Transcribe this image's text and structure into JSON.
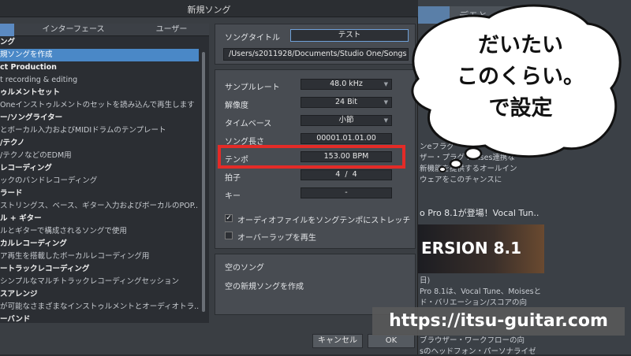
{
  "dialog": {
    "title": "新規ソング"
  },
  "category_tabs": [
    {
      "label": ""
    },
    {
      "label": "インターフェース"
    },
    {
      "label": "ユーザー"
    }
  ],
  "templates": [
    {
      "label": "ング",
      "kind": "head"
    },
    {
      "label": "規ソングを作成",
      "kind": "selected"
    },
    {
      "label": "ct Production",
      "kind": "head"
    },
    {
      "label": "t recording & editing",
      "kind": "sub"
    },
    {
      "label": "ゥルメントセット",
      "kind": "head"
    },
    {
      "label": "Oneインストゥルメントのセットを読み込んで再生します",
      "kind": "sub"
    },
    {
      "label": "ー/ソングライター",
      "kind": "head"
    },
    {
      "label": "とボーカル入力およびMIDIドラムのテンプレート",
      "kind": "sub"
    },
    {
      "label": "/テクノ",
      "kind": "head"
    },
    {
      "label": "/テクノなどのEDM用",
      "kind": "sub"
    },
    {
      "label": "レコーディング",
      "kind": "head"
    },
    {
      "label": "ックのバンドレコーディング",
      "kind": "sub"
    },
    {
      "label": "ラード",
      "kind": "head"
    },
    {
      "label": "ストリングス、ベース、ギター入力およびボーカルのPOP...",
      "kind": "sub"
    },
    {
      "label": "ル + ギター",
      "kind": "head"
    },
    {
      "label": "ルとギターで構成されるソングで使用",
      "kind": "sub"
    },
    {
      "label": "カルレコーディング",
      "kind": "head"
    },
    {
      "label": "ア再生を搭載したボーカルレコーディング用",
      "kind": "sub"
    },
    {
      "label": "ートラックレコーディング",
      "kind": "head"
    },
    {
      "label": "シンプルなマルチトラックレコーディングセッション",
      "kind": "sub"
    },
    {
      "label": "スアレンジ",
      "kind": "head"
    },
    {
      "label": "が可能なさまざまなインストゥルメントとオーディオトラ...",
      "kind": "sub"
    },
    {
      "label": "ーバンド",
      "kind": "head"
    }
  ],
  "song": {
    "title_label": "ソングタイトル",
    "title_value": "テスト",
    "path_value": "/Users/s2011928/Documents/Studio One/Songs"
  },
  "settings": {
    "sample_rate": {
      "label": "サンプルレート",
      "value": "48.0 kHz"
    },
    "resolution": {
      "label": "解像度",
      "value": "24 Bit"
    },
    "timebase": {
      "label": "タイムベース",
      "value": "小節"
    },
    "song_length": {
      "label": "ソング長さ",
      "value": "00001.01.01.00"
    },
    "tempo": {
      "label": "テンポ",
      "value": "153.00 BPM"
    },
    "time_signature": {
      "label": "拍子",
      "numerator": "4",
      "slash": "/",
      "denominator": "4"
    },
    "key": {
      "label": "キー",
      "value": "-"
    },
    "stretch": {
      "label": "オーディオファイルをソングテンポにストレッチ",
      "checked": "✓"
    },
    "loop": {
      "label": "オーバーラップを再生"
    }
  },
  "description": {
    "title": "空のソング",
    "text": "空の新規ソングを作成"
  },
  "buttons": {
    "cancel": "キャンセル",
    "ok": "OK"
  },
  "background": {
    "tab_label": "デモと",
    "promo_lines": [
      "ンeフラグ",
      "ザー・プラグ       Moises連携な",
      "        新機能を提供するオールイン",
      "        ウェアをこのチャンスに"
    ],
    "headline": "o Pro 8.1が登場！Vocal Tun..",
    "banner_text": "ERSION 8.1",
    "article_lines": [
      "日)",
      "Pro 8.1は、Vocal Tune、Moisesと",
      "ド・バリエーション/スコアの向",
      "ブラウザー・ワークフローの向",
      "sのヘッドフォン・パーソナライゼ"
    ]
  },
  "annotation": {
    "bubble_lines": [
      "だいたい",
      "このくらい。",
      "で設定"
    ],
    "watermark": "https://itsu-guitar.com"
  }
}
